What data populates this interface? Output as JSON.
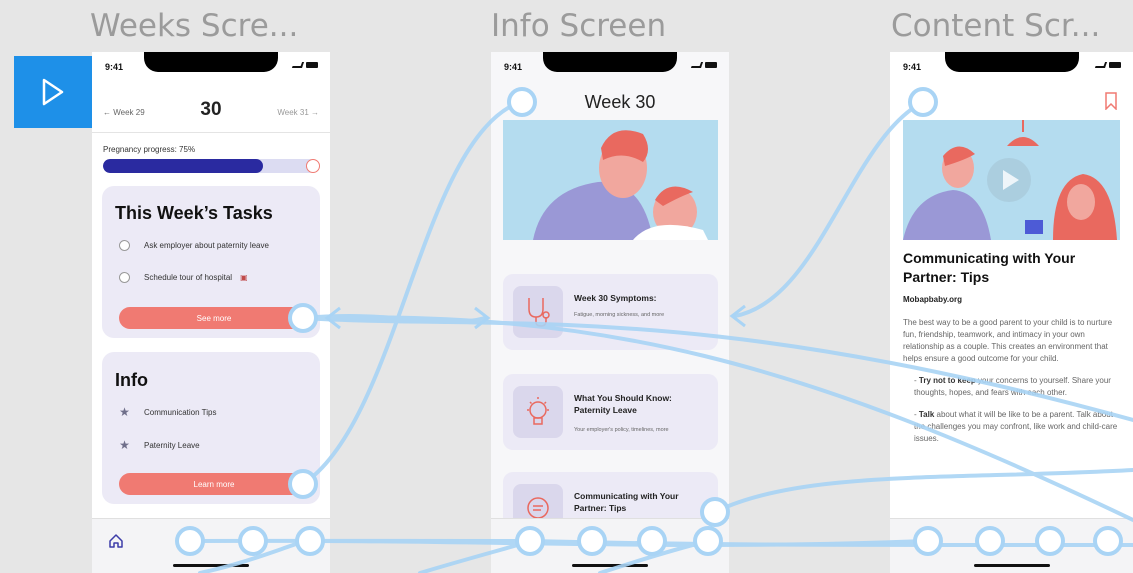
{
  "canvas": {
    "screen_labels": [
      "Weeks Scre...",
      "Info Screen",
      "Content Scr..."
    ]
  },
  "weeks": {
    "time": "9:41",
    "prev": "← Week 29",
    "current": "30",
    "next": "Week 31 →",
    "progress_label": "Pregnancy progress: 75%",
    "progress": 0.75,
    "tasks_title": "This Week’s Tasks",
    "tasks": [
      "Ask employer about paternity leave",
      "Schedule tour of hospital"
    ],
    "tasks_button": "See more",
    "info_title": "Info",
    "info_items": [
      "Communication Tips",
      "Paternity Leave"
    ],
    "info_button": "Learn more"
  },
  "info": {
    "time": "9:41",
    "title": "Week 30",
    "cards": [
      {
        "title": "Week 30 Symptoms:",
        "subtitle": "Fatigue, morning sickness, and more",
        "icon": "stethoscope-icon"
      },
      {
        "title": "What You Should Know: Paternity Leave",
        "subtitle": "Your employer's policy, timelines, more",
        "icon": "lightbulb-icon"
      },
      {
        "title": "Communicating with Your Partner: Tips",
        "subtitle": "",
        "icon": "chat-icon"
      }
    ]
  },
  "content": {
    "time": "9:41",
    "title": "Communicating with Your Partner: Tips",
    "source": "Mobapbaby.org",
    "intro": "The best way to be a good parent to your child is to nurture fun, friendship, teamwork, and intimacy in your own relationship as a couple. This creates an environment that helps ensure a good outcome for your child.",
    "tip1_bold": "Try not to keep",
    "tip1_rest": " your concerns to yourself. Share your thoughts, hopes, and fears with each other.",
    "tip2_bold": "Talk",
    "tip2_rest": " about what it will be like to be a parent. Talk about the challenges you may confront, like work and child-care issues."
  },
  "colors": {
    "accent": "#f07a72",
    "progress": "#2a2aa0",
    "card": "#eceaf6",
    "wire": "#a9d4f5",
    "play": "#1e90e8"
  }
}
